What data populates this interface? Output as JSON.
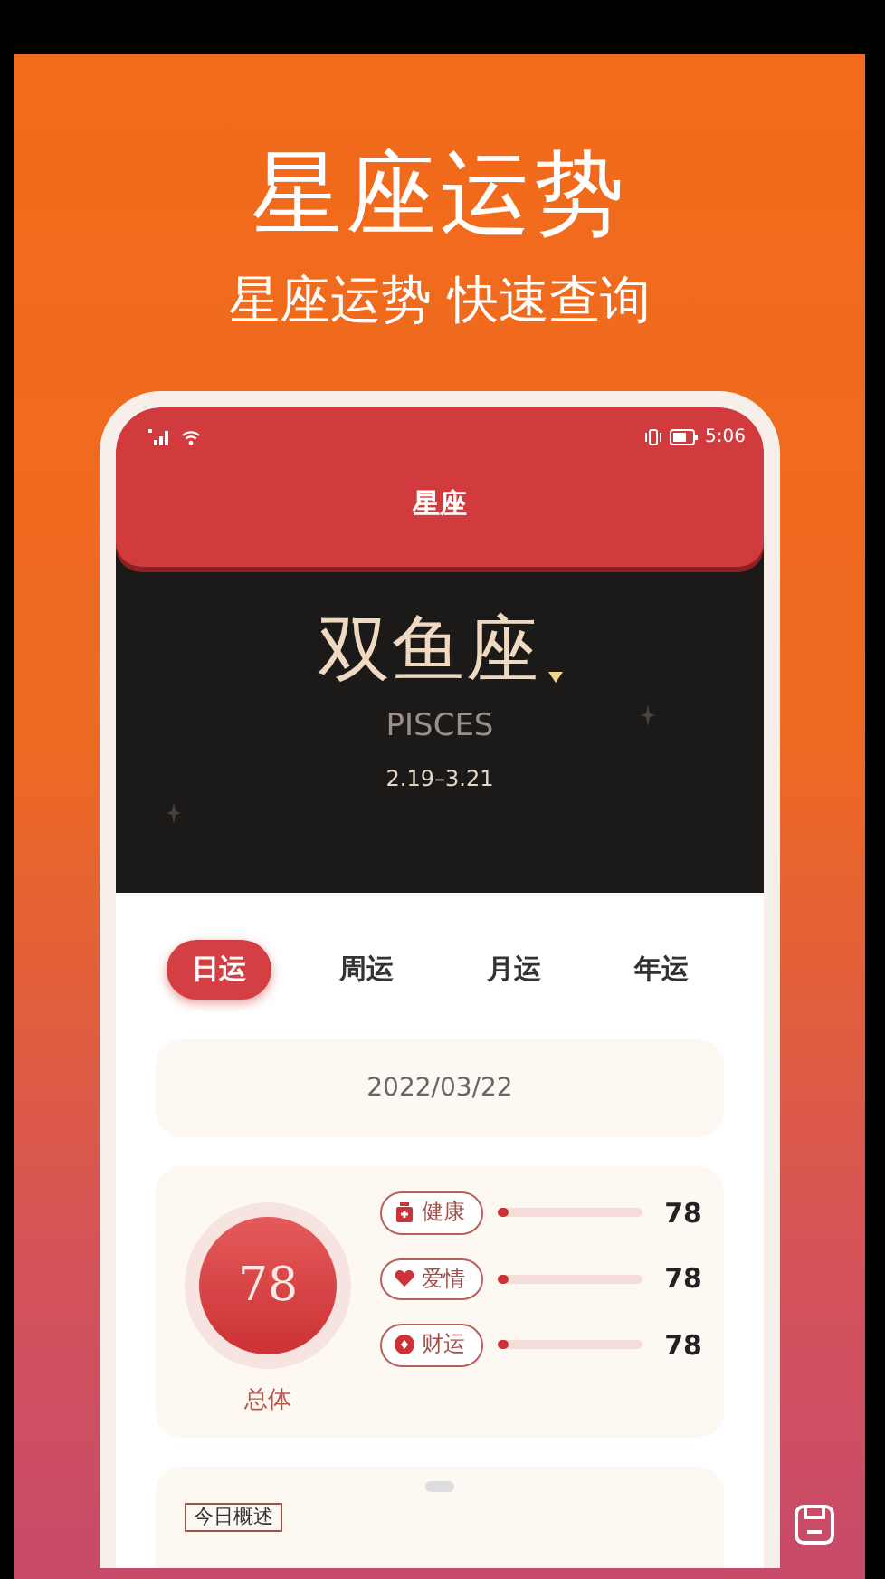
{
  "promo": {
    "title": "星座运势",
    "subtitle": "星座运势 快速查询"
  },
  "status_bar": {
    "time": "5:06"
  },
  "header": {
    "title": "星座"
  },
  "sign": {
    "name": "双鱼座",
    "latin": "PISCES",
    "dates": "2.19–3.21"
  },
  "tabs": [
    {
      "label": "日运",
      "selected": true
    },
    {
      "label": "周运",
      "selected": false
    },
    {
      "label": "月运",
      "selected": false
    },
    {
      "label": "年运",
      "selected": false
    }
  ],
  "date": "2022/03/22",
  "overall": {
    "score": "78",
    "label": "总体"
  },
  "aspects": [
    {
      "kind": "health",
      "label": "健康",
      "level": 0.08,
      "score": "78"
    },
    {
      "kind": "love",
      "label": "爱情",
      "level": 0.08,
      "score": "78"
    },
    {
      "kind": "wealth",
      "label": "财运",
      "level": 0.08,
      "score": "78"
    }
  ],
  "summary": {
    "title": "今日概述"
  }
}
